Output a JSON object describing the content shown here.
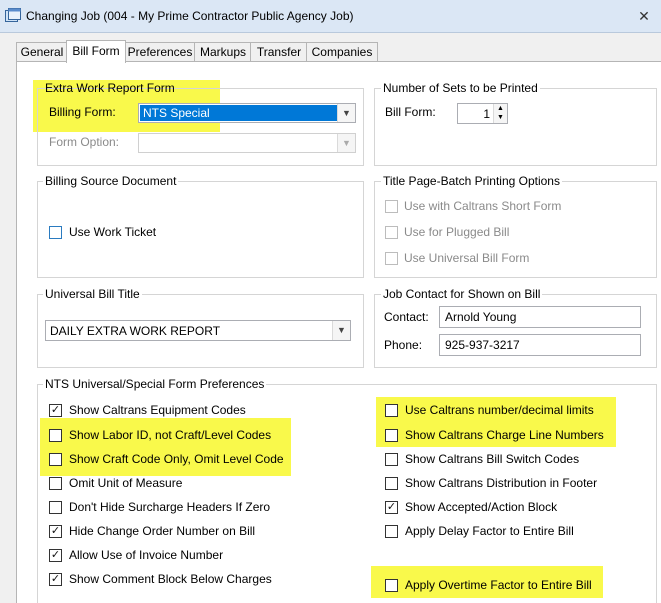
{
  "window": {
    "title": "Changing Job  (004 - My Prime Contractor Public Agency Job)",
    "close_glyph": "✕"
  },
  "tabs": [
    "General",
    "Bill Form",
    "Preferences",
    "Markups",
    "Transfer",
    "Companies"
  ],
  "active_tab": "Bill Form",
  "extra_work": {
    "title": "Extra Work Report Form",
    "billing_form_label": "Billing Form:",
    "billing_form_value": "NTS Special",
    "form_option_label": "Form Option:",
    "form_option_value": ""
  },
  "sets": {
    "title": "Number of Sets to be Printed",
    "bill_form_label": "Bill Form:",
    "bill_form_value": "1"
  },
  "billing_source": {
    "title": "Billing Source Document",
    "use_work_ticket": "Use Work Ticket"
  },
  "title_page": {
    "title": "Title Page-Batch Printing Options",
    "options": [
      "Use with Caltrans Short Form",
      "Use for Plugged Bill",
      "Use Universal Bill Form"
    ]
  },
  "universal_title": {
    "title": "Universal Bill Title",
    "value": "DAILY EXTRA WORK REPORT"
  },
  "job_contact": {
    "title": "Job Contact for Shown on Bill",
    "contact_label": "Contact:",
    "contact_value": "Arnold Young",
    "phone_label": "Phone:",
    "phone_value": "925-937-3217"
  },
  "nts_prefs": {
    "title": "NTS Universal/Special Form Preferences",
    "left": [
      {
        "label": "Show Caltrans Equipment Codes",
        "checked": true
      },
      {
        "label": "Show Labor ID, not Craft/Level Codes",
        "checked": false
      },
      {
        "label": "Show Craft Code Only, Omit Level Code",
        "checked": false
      },
      {
        "label": "Omit Unit of Measure",
        "checked": false
      },
      {
        "label": "Don't Hide Surcharge Headers If Zero",
        "checked": false
      },
      {
        "label": "Hide Change Order Number on Bill",
        "checked": true
      },
      {
        "label": "Allow Use of Invoice Number",
        "checked": true
      },
      {
        "label": "Show Comment Block Below Charges",
        "checked": true
      }
    ],
    "right": [
      {
        "label": "Use Caltrans number/decimal limits",
        "checked": false
      },
      {
        "label": "Show Caltrans Charge Line Numbers",
        "checked": false
      },
      {
        "label": "Show Caltrans Bill Switch Codes",
        "checked": false
      },
      {
        "label": "Show Caltrans Distribution in Footer",
        "checked": false
      },
      {
        "label": "Show Accepted/Action Block",
        "checked": true
      },
      {
        "label": "Apply Delay Factor to Entire Bill",
        "checked": false
      },
      {
        "label": "Apply Overtime Factor to Entire Bill",
        "checked": false
      }
    ]
  },
  "colors": {
    "highlight": "#f9f94b",
    "selection": "#0078d7",
    "selection_text": "#ffffff"
  }
}
